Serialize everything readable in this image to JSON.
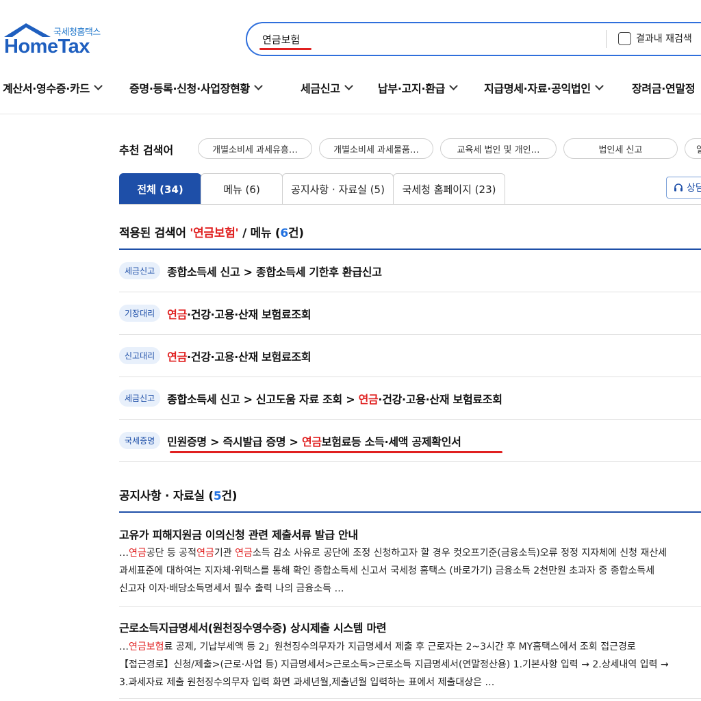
{
  "logo": {
    "sub": "국세청홈택스",
    "main": "HomeTax"
  },
  "search": {
    "query": "연금보험",
    "research_label": "결과내 재검색"
  },
  "nav": [
    {
      "label": "계산서·영수증·카드"
    },
    {
      "label": "증명·등록·신청·사업장현황"
    },
    {
      "label": "세금신고"
    },
    {
      "label": "납부·고지·환급"
    },
    {
      "label": "지급명세·자료·공익법인"
    },
    {
      "label": "장려금·연말정"
    }
  ],
  "recommended": {
    "label": "추천 검색어",
    "chips": [
      "개별소비세 과세유흥…",
      "개별소비세 과세물품…",
      "교육세 법인 및 개인…",
      "법인세 신고",
      "일"
    ]
  },
  "tabs": [
    {
      "label": "전체 (34)"
    },
    {
      "label": "메뉴 (6)"
    },
    {
      "label": "공지사항 · 자료실 (5)"
    },
    {
      "label": "국세청 홈페이지 (23)"
    }
  ],
  "consult_label": "상담",
  "menu_section": {
    "prefix": "적용된 검색어 ",
    "keyword": "'연금보험'",
    "mid": " / 메뉴 (",
    "count": "6",
    "suffix": "건)"
  },
  "menu_rows": [
    {
      "badge": "세금신고",
      "pre": "종합소득세 신고 > 종합소득세 기한후 환급신고",
      "hl": "",
      "post": ""
    },
    {
      "badge": "기장대리",
      "pre": "",
      "hl": "연금",
      "post": "·건강·고용·산재 보험료조회"
    },
    {
      "badge": "신고대리",
      "pre": "",
      "hl": "연금",
      "post": "·건강·고용·산재 보험료조회"
    },
    {
      "badge": "세금신고",
      "pre": "종합소득세 신고 > 신고도움 자료 조회 > ",
      "hl": "연금",
      "post": "·건강·고용·산재 보험료조회"
    },
    {
      "badge": "국세증명",
      "pre": "민원증명 > 즉시발급 증명 > ",
      "hl": "연금",
      "post": "보험료등 소득·세액 공제확인서"
    }
  ],
  "notice_section": {
    "title": "공지사항 · 자료실 (",
    "count": "5",
    "suffix": "건)"
  },
  "notices": [
    {
      "title": "고유가 피해지원금 이의신청 관련 제출서류 발급 안내",
      "line1": [
        {
          "t": "…",
          "hl": false
        },
        {
          "t": "연금",
          "hl": true
        },
        {
          "t": "공단 등 공적",
          "hl": false
        },
        {
          "t": "연금",
          "hl": true
        },
        {
          "t": "기관 ",
          "hl": false
        },
        {
          "t": "연금",
          "hl": true
        },
        {
          "t": "소득 감소 사유로 공단에 조정 신청하고자 할 경우 컷오프기준(금융소득)오류 정정 지자체에 신청 재산세",
          "hl": false
        }
      ],
      "line2": "과세표준에 대하여는 지자체·위택스를 통해 확인 종합소득세 신고서 국세청 홈택스 (바로가기) 금융소득 2천만원 초과자 중 종합소득세",
      "line3": "신고자 이자·배당소득명세서 필수 출력 나의 금융소득 …"
    },
    {
      "title": "근로소득지급명세서(원천징수영수증) 상시제출 시스템 마련",
      "line1": [
        {
          "t": "…",
          "hl": false
        },
        {
          "t": "연금보험",
          "hl": true
        },
        {
          "t": "료 공제, 기납부세액 등 2」원천징수의무자가 지급명세서 제출 후 근로자는 2~3시간 후 MY홈택스에서 조회 접근경로",
          "hl": false
        }
      ],
      "line2": "【접근경로】신청/제출>(근로·사업 등) 지급명세서>근로소득>근로소득 지급명세서(연말정산용) 1.기본사항 입력 → 2.상세내역 입력 →",
      "line3": "3.과세자료 제출 원천징수의무자 입력 화면 과세년월,제출년월 입력하는 표에서 제출대상은 …"
    }
  ]
}
